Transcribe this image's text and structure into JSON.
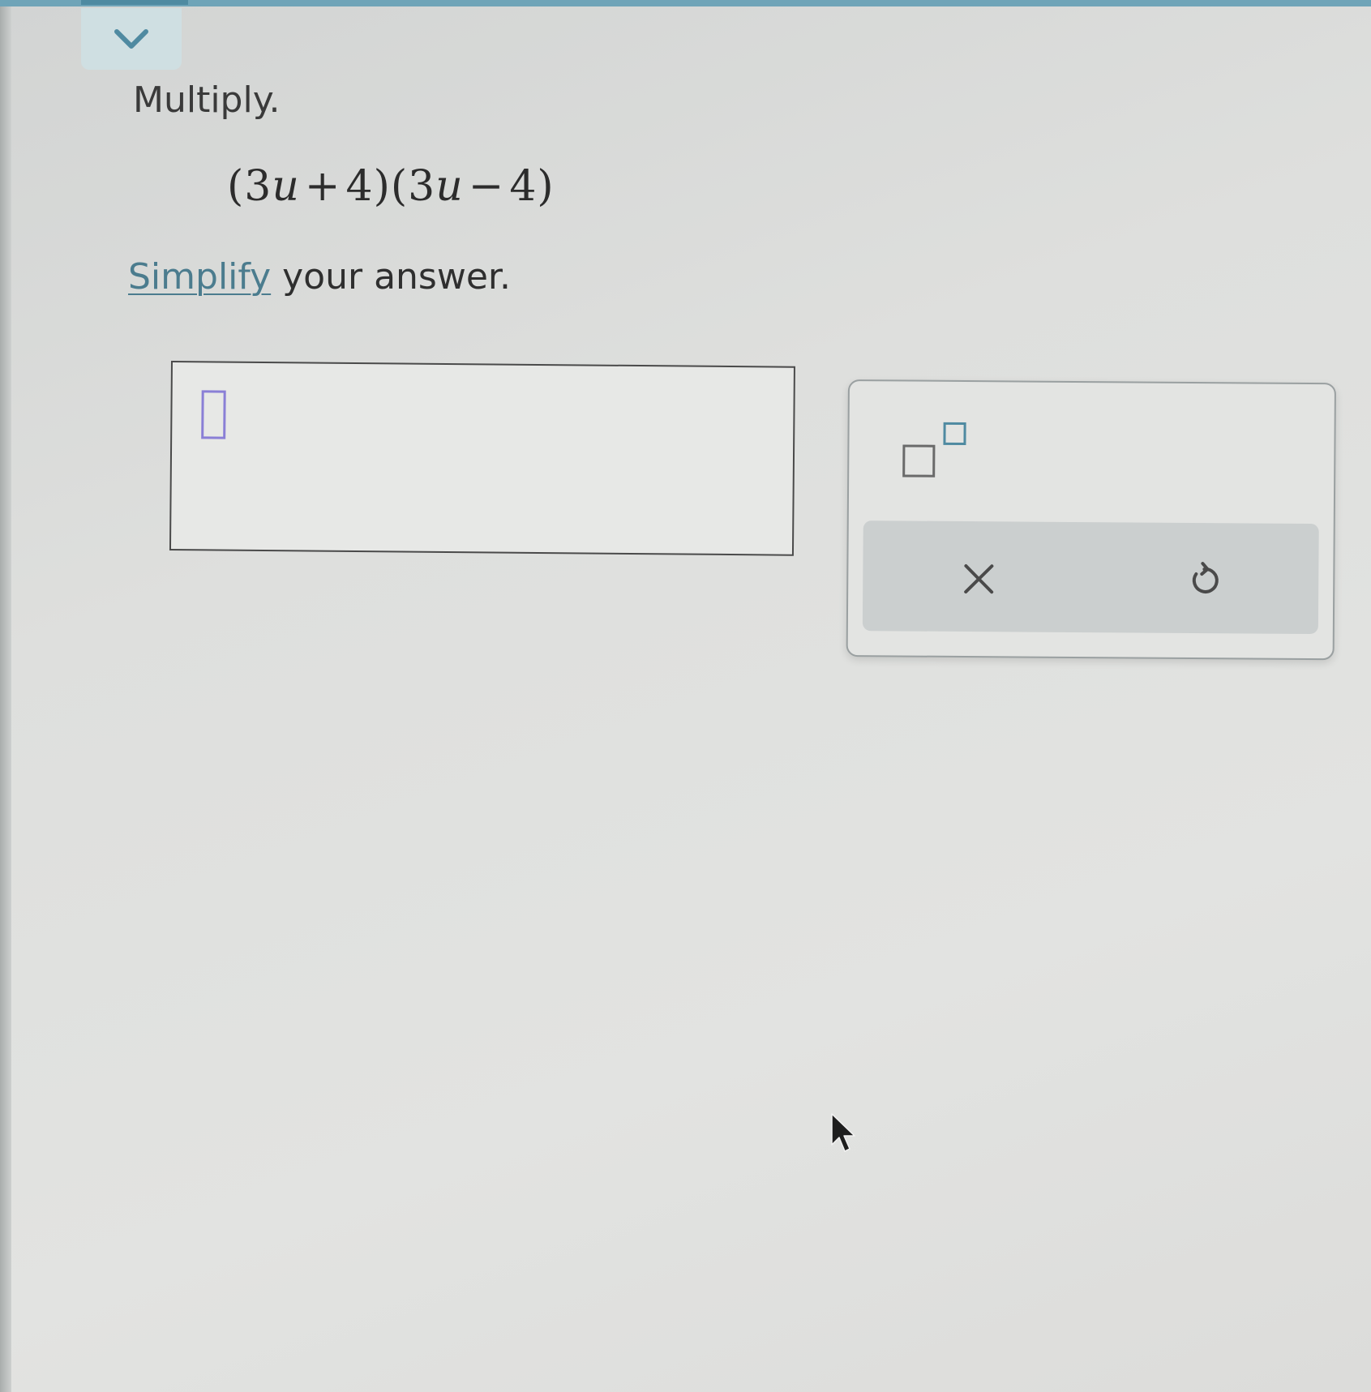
{
  "header": {
    "collapse_icon": "chevron-down-icon"
  },
  "question": {
    "title": "Multiply.",
    "expression": {
      "f1_open": "(",
      "f1_coef": "3",
      "f1_var": "u",
      "f1_op": "+",
      "f1_const": "4",
      "f1_close": ")",
      "f2_open": "(",
      "f2_coef": "3",
      "f2_var": "u",
      "f2_op": "−",
      "f2_const": "4",
      "f2_close": ")"
    },
    "instruction_link": "Simplify",
    "instruction_rest": " your answer."
  },
  "answer": {
    "value": ""
  },
  "toolbar": {
    "superscript_icon": "superscript-template-icon",
    "clear_icon": "close-icon",
    "undo_icon": "undo-icon"
  },
  "colors": {
    "accent": "#4f8aa1",
    "cursor": "#8a7fd6",
    "link": "#4b7c8e"
  }
}
